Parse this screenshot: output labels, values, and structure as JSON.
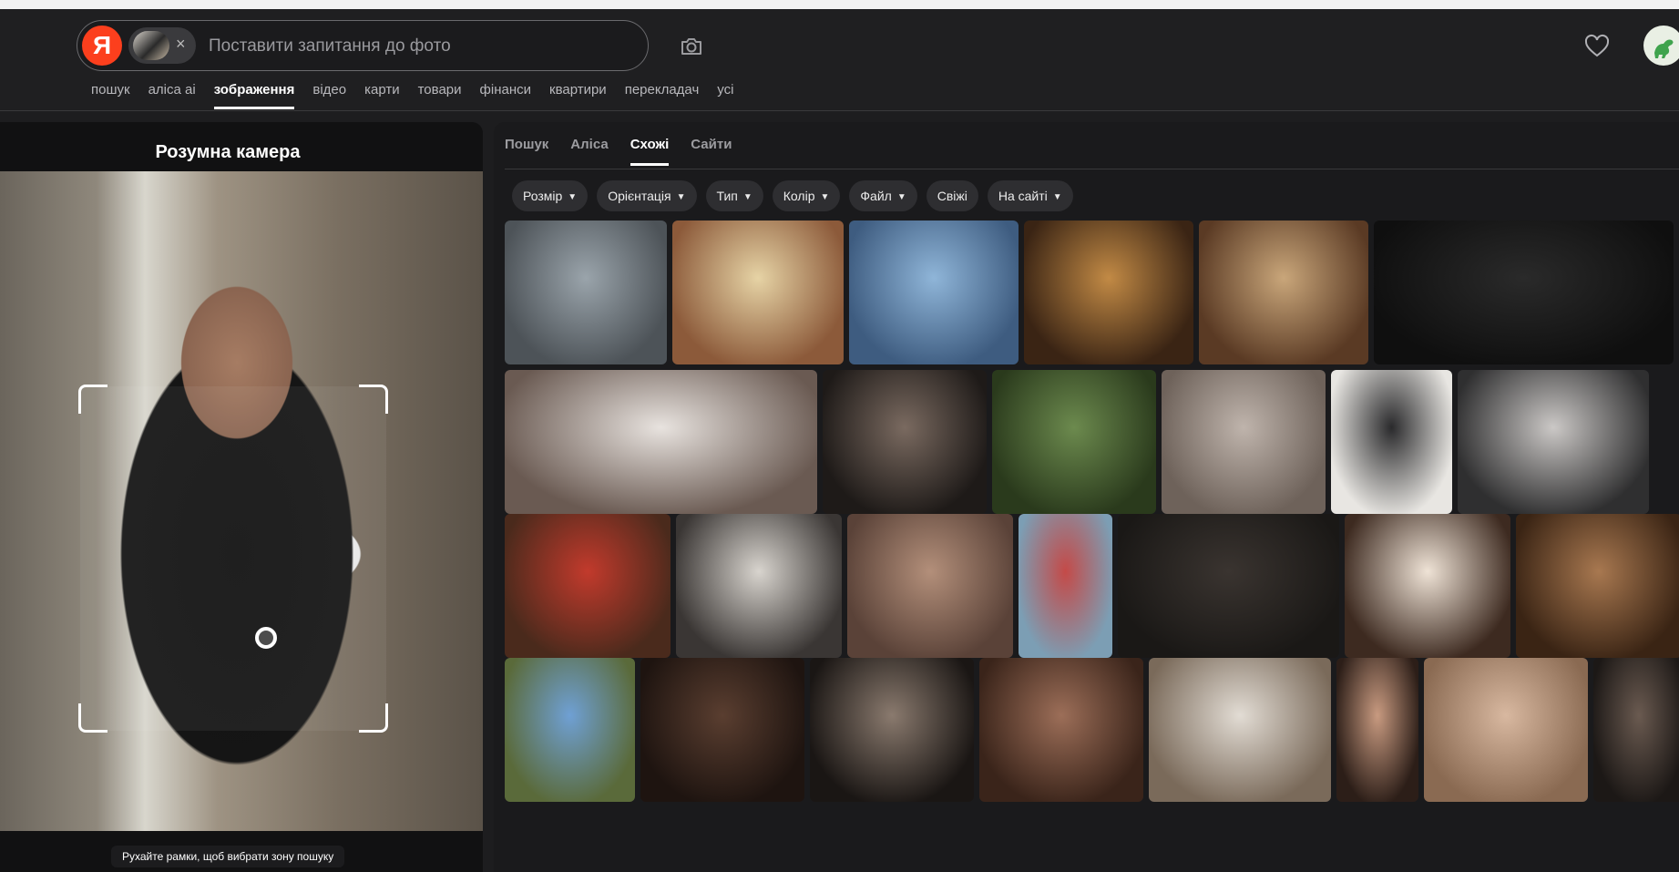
{
  "header": {
    "logo_letter": "Я",
    "search_placeholder": "Поставити запитання до фото",
    "remove_image_symbol": "×"
  },
  "nav": {
    "items": [
      "пошук",
      "аліса ai",
      "зображення",
      "відео",
      "карти",
      "товари",
      "фінанси",
      "квартири",
      "перекладач",
      "усі"
    ],
    "active": "зображення"
  },
  "left_panel": {
    "title": "Розумна камера",
    "hint": "Рухайте рамки, щоб вибрати зону пошуку"
  },
  "tabs": {
    "items": [
      "Пошук",
      "Аліса",
      "Схожі",
      "Сайти"
    ],
    "active": "Схожі"
  },
  "filters": [
    {
      "label": "Розмір",
      "dropdown": true
    },
    {
      "label": "Орієнтація",
      "dropdown": true
    },
    {
      "label": "Тип",
      "dropdown": true
    },
    {
      "label": "Колір",
      "dropdown": true
    },
    {
      "label": "Файл",
      "dropdown": true
    },
    {
      "label": "Свіжі",
      "dropdown": false
    },
    {
      "label": "На сайті",
      "dropdown": true
    }
  ],
  "results_grid": {
    "rows": [
      {
        "tiles": [
          {
            "w": 178,
            "c1": "#9aa4ab",
            "c2": "#4d5358"
          },
          {
            "w": 188,
            "c1": "#e6d3a5",
            "c2": "#8c5a3a"
          },
          {
            "w": 186,
            "c1": "#8fb5d8",
            "c2": "#3e5c80"
          },
          {
            "w": 186,
            "c1": "#c28a45",
            "c2": "#3a2414"
          },
          {
            "w": 186,
            "c1": "#c9a67a",
            "c2": "#5a3a24"
          },
          {
            "w": 329,
            "c1": "#2a2a2a",
            "c2": "#0f0f0f"
          }
        ]
      },
      {
        "tiles": [
          {
            "w": 343,
            "c1": "#e8e3df",
            "c2": "#6a5a52"
          },
          {
            "w": 180,
            "c1": "#7a6a60",
            "c2": "#1e1a18"
          },
          {
            "w": 180,
            "c1": "#6c8a4e",
            "c2": "#2a3a1c"
          },
          {
            "w": 180,
            "c1": "#bfb4ac",
            "c2": "#6e625a"
          },
          {
            "w": 133,
            "c1": "#2a2a2c",
            "c2": "#e8e6e2"
          },
          {
            "w": 210,
            "c1": "#cbc8c6",
            "c2": "#2f2f30"
          }
        ]
      },
      {
        "tiles": [
          {
            "w": 182,
            "c1": "#c23a2c",
            "c2": "#4a2a1c"
          },
          {
            "w": 182,
            "c1": "#d8d4ce",
            "c2": "#3a3634"
          },
          {
            "w": 182,
            "c1": "#b38f7a",
            "c2": "#5a4238"
          },
          {
            "w": 103,
            "c1": "#c44a48",
            "c2": "#7c9eb4"
          },
          {
            "w": 243,
            "c1": "#3a3430",
            "c2": "#1a1816"
          },
          {
            "w": 182,
            "c1": "#efe3d6",
            "c2": "#3d2a20"
          },
          {
            "w": 182,
            "c1": "#a87850",
            "c2": "#3a2414"
          }
        ]
      },
      {
        "tiles": [
          {
            "w": 143,
            "c1": "#6fa0d4",
            "c2": "#5a6a3a"
          },
          {
            "w": 180,
            "c1": "#5a3e30",
            "c2": "#1e1410"
          },
          {
            "w": 180,
            "c1": "#8a7a6e",
            "c2": "#1a1614"
          },
          {
            "w": 180,
            "c1": "#9c6e58",
            "c2": "#3a241a"
          },
          {
            "w": 200,
            "c1": "#e2dcd4",
            "c2": "#7a6a5a"
          },
          {
            "w": 90,
            "c1": "#c89a80",
            "c2": "#2c1e18"
          },
          {
            "w": 180,
            "c1": "#d8b8a0",
            "c2": "#8a6a52"
          },
          {
            "w": 100,
            "c1": "#6a5a50",
            "c2": "#1c1816"
          }
        ]
      }
    ]
  }
}
